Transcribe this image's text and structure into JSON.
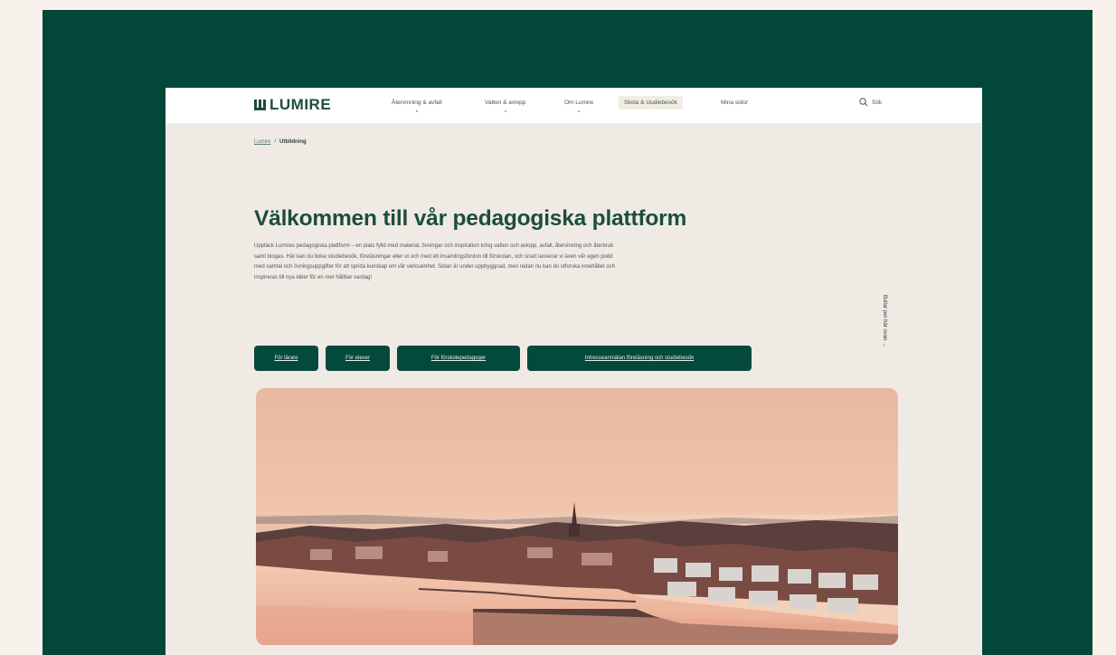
{
  "brand": {
    "name": "LUMIRE"
  },
  "nav": {
    "items": [
      {
        "label": "Återvinning & avfall"
      },
      {
        "label": "Vatten & avlopp"
      },
      {
        "label": "Om Lumire"
      },
      {
        "label": "Skola & studiebesök"
      },
      {
        "label": "Mina sidor"
      }
    ],
    "search_label": "Sök"
  },
  "breadcrumb": {
    "home": "Lumire",
    "separator": "/",
    "current": "Utbildning"
  },
  "page": {
    "title": "Välkommen till vår pedagogiska plattform",
    "intro": "Upptäck Lumires pedagogiska plattform – en plats fylld med material, övningar och inspiration kring vatten och avlopp, avfall, återvinning och återbruk samt biogas. Här kan du boka studiebesök, föreläsningar eller ut och med ett insamlingsfordon till förskolan, och snart lanserar vi även vår egen podd med samtal och övningsuppgifter för att sprida kunskap om vår verksamhet. Sidan är under uppbyggnad, men redan nu kan du utforska innehållet och inspireras till nya idéer för en mer hållbar vardag!"
  },
  "buttons": [
    {
      "label": "För lärare"
    },
    {
      "label": "För elever"
    },
    {
      "label": "För förskolepedagoger"
    },
    {
      "label": "Intresseanmälan föreläsning och studiebesök"
    }
  ],
  "side_link": {
    "label": "Bullar per här ovan →"
  },
  "hero": {
    "alt": "Aerial view of a coastal city at sunset"
  },
  "colors": {
    "background": "#f6f1ea",
    "frame": "#03473b",
    "site_background": "#efebe4",
    "brand_green": "#1c4d3f",
    "button_green": "#034a3c"
  },
  "icons": {
    "logo": "lumire-logo-icon",
    "search": "search-icon"
  }
}
